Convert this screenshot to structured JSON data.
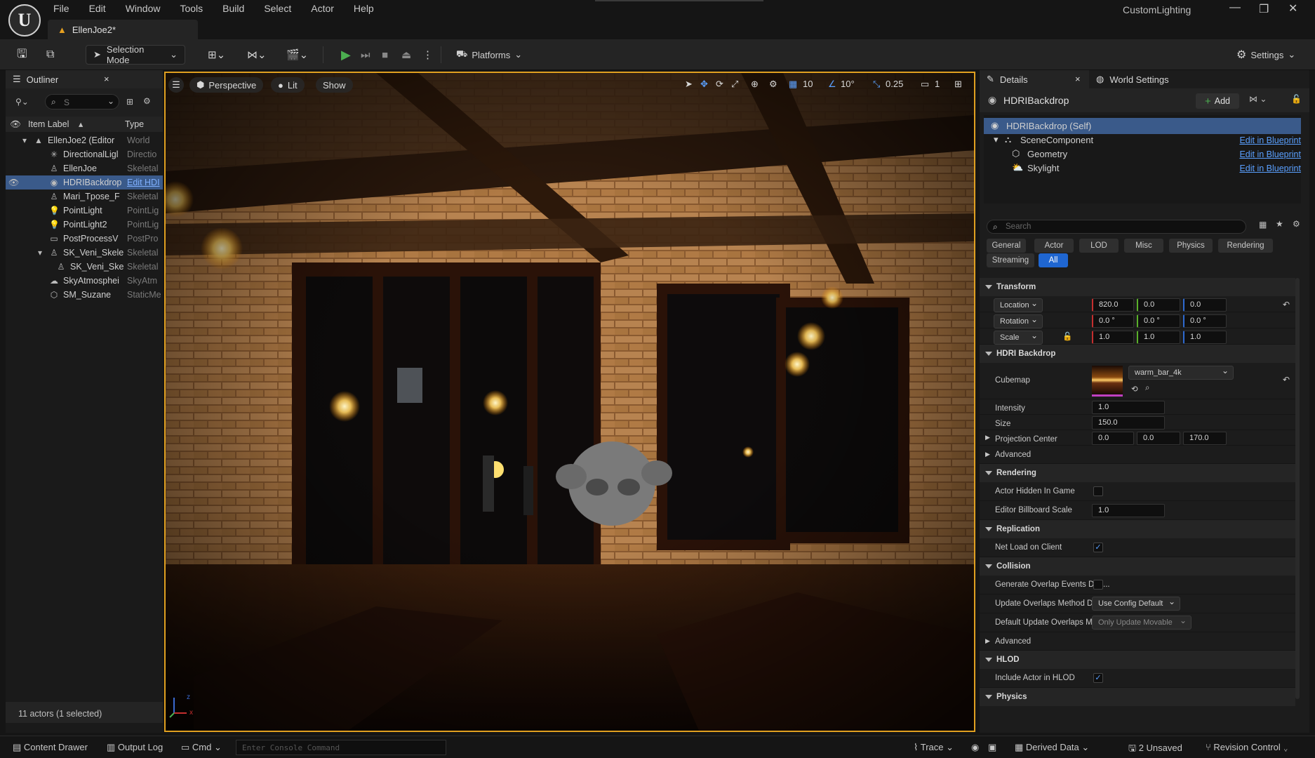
{
  "menu": [
    "File",
    "Edit",
    "Window",
    "Tools",
    "Build",
    "Select",
    "Actor",
    "Help"
  ],
  "document_tab": "EllenJoe2*",
  "project_name": "CustomLighting",
  "toolbar": {
    "selection_mode": "Selection Mode",
    "platforms": "Platforms",
    "settings": "Settings"
  },
  "outliner": {
    "title": "Outliner",
    "search_value": "S",
    "col_label": "Item Label",
    "col_type": "Type",
    "rows": [
      {
        "label": "EllenJoe2 (Editor",
        "type": "World"
      },
      {
        "label": "DirectionalLigl",
        "type": "Directio"
      },
      {
        "label": "EllenJoe",
        "type": "Skeletal"
      },
      {
        "label": "HDRIBackdrop",
        "type": "Edit HDI"
      },
      {
        "label": "Mari_Tpose_F",
        "type": "Skeletal"
      },
      {
        "label": "PointLight",
        "type": "PointLig"
      },
      {
        "label": "PointLight2",
        "type": "PointLig"
      },
      {
        "label": "PostProcessV",
        "type": "PostPro"
      },
      {
        "label": "SK_Veni_Skele",
        "type": "Skeletal"
      },
      {
        "label": "SK_Veni_Ske",
        "type": "Skeletal"
      },
      {
        "label": "SkyAtmosphei",
        "type": "SkyAtm"
      },
      {
        "label": "SM_Suzane",
        "type": "StaticMe"
      }
    ],
    "footer": "11 actors (1 selected)"
  },
  "viewport": {
    "perspective": "Perspective",
    "lit": "Lit",
    "show": "Show",
    "grid_snap": "10",
    "rot_snap": "10°",
    "scale_snap": "0.25",
    "camera_speed": "1",
    "axis_z": "z",
    "axis_x": "x"
  },
  "details": {
    "tab_details": "Details",
    "tab_world": "World Settings",
    "actor_name": "HDRIBackdrop",
    "add_label": "Add",
    "components": [
      {
        "label": "HDRIBackdrop (Self)",
        "link": ""
      },
      {
        "label": "SceneComponent",
        "link": "Edit in Blueprint"
      },
      {
        "label": "Geometry",
        "link": "Edit in Blueprint"
      },
      {
        "label": "Skylight",
        "link": "Edit in Blueprint"
      }
    ],
    "search_placeholder": "Search",
    "categories": [
      "General",
      "Actor",
      "LOD",
      "Misc",
      "Physics",
      "Rendering",
      "Streaming",
      "All"
    ],
    "transform": {
      "title": "Transform",
      "location_label": "Location",
      "rotation_label": "Rotation",
      "scale_label": "Scale",
      "location": [
        "820.0",
        "0.0",
        "0.0"
      ],
      "rotation": [
        "0.0 °",
        "0.0 °",
        "0.0 °"
      ],
      "scale": [
        "1.0",
        "1.0",
        "1.0"
      ]
    },
    "hdri": {
      "title": "HDRI Backdrop",
      "cubemap_label": "Cubemap",
      "cubemap_value": "warm_bar_4k",
      "intensity_label": "Intensity",
      "intensity": "1.0",
      "size_label": "Size",
      "size": "150.0",
      "projection_label": "Projection Center",
      "projection": [
        "0.0",
        "0.0",
        "170.0"
      ],
      "advanced": "Advanced"
    },
    "rendering": {
      "title": "Rendering",
      "hidden_label": "Actor Hidden In Game",
      "billboard_label": "Editor Billboard Scale",
      "billboard": "1.0"
    },
    "replication": {
      "title": "Replication",
      "net_load_label": "Net Load on Client"
    },
    "collision": {
      "title": "Collision",
      "overlap_label": "Generate Overlap Events Duri...",
      "update_label": "Update Overlaps Method Duri...",
      "update_value": "Use Config Default",
      "default_label": "Default Update Overlaps Met...",
      "default_value": "Only Update Movable",
      "advanced": "Advanced"
    },
    "hlod": {
      "title": "HLOD",
      "include_label": "Include Actor in HLOD"
    },
    "physics_title": "Physics"
  },
  "statusbar": {
    "content_drawer": "Content Drawer",
    "output_log": "Output Log",
    "cmd": "Cmd",
    "console_placeholder": "Enter Console Command",
    "trace": "Trace",
    "derived_data": "Derived Data",
    "unsaved": "2 Unsaved",
    "revision": "Revision Control"
  },
  "colors": {
    "accent": "#e0a020",
    "link": "#5aa0ff",
    "selected": "#3a5a8a",
    "play": "#4caf50"
  }
}
